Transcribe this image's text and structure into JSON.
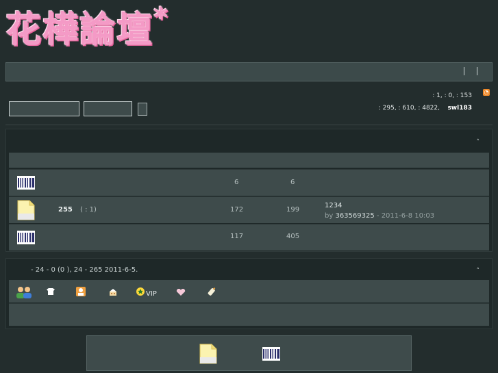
{
  "logo": {
    "text": "花樺論壇",
    "star": "*"
  },
  "stats": {
    "line1": ": 1,   : 0,   : 153",
    "line2": ": 295,   : 610,   : 4822,",
    "newest_member": "swl183"
  },
  "forums": [
    {
      "name": "",
      "sub": "",
      "topics": "6",
      "posts": "6",
      "icon": "forum-old-icon",
      "last_title": "",
      "last_by": "",
      "last_time": ""
    },
    {
      "name": "255",
      "sub": "( : 1)",
      "topics": "172",
      "posts": "199",
      "icon": "forum-new-icon",
      "last_title": "1234",
      "last_by_prefix": "by",
      "last_by": "363569325",
      "last_time": "- 2011-6-8 10:03"
    },
    {
      "name": "",
      "sub": "",
      "topics": "117",
      "posts": "405",
      "icon": "forum-old-icon",
      "last_title": "",
      "last_by": "",
      "last_time": ""
    }
  ],
  "online": {
    "summary": "- 24    - 0  (0  ), 24    -      265  2011-6-5.",
    "legend": [
      {
        "icon": "group-users-icon",
        "label": ""
      },
      {
        "icon": "shirt-icon",
        "label": ""
      },
      {
        "icon": "contact-card-icon",
        "label": ""
      },
      {
        "icon": "cake-icon",
        "label": ""
      },
      {
        "icon": "star-badge-icon",
        "label": "VIP"
      },
      {
        "icon": "heart-icon",
        "label": ""
      },
      {
        "icon": "feeding-bottle-icon",
        "label": ""
      }
    ]
  },
  "colors": {
    "background": "#232d2d",
    "panel": "#3e4b4b",
    "logo_pink": "#f49ac6",
    "rss_orange": "#f08a2a"
  },
  "collapse_symbol": "˄"
}
